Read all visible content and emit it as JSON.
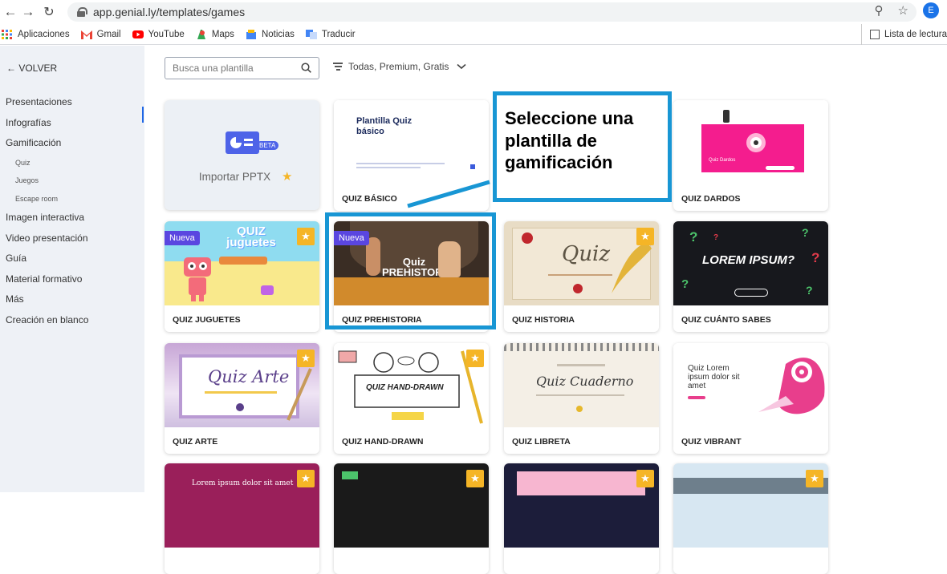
{
  "browser": {
    "url": "app.genial.ly/templates/games",
    "profile_initial": "E",
    "bookmarks": [
      "Aplicaciones",
      "Gmail",
      "YouTube",
      "Maps",
      "Noticias",
      "Traducir"
    ],
    "reading_list": "Lista de lectura"
  },
  "sidebar": {
    "back": "← VOLVER",
    "items": [
      "Presentaciones",
      "Infografías",
      "Gamificación"
    ],
    "subitems": [
      "Quiz",
      "Juegos",
      "Escape room"
    ],
    "items_after": [
      "Imagen interactiva",
      "Video presentación",
      "Guía",
      "Material formativo",
      "Más",
      "Creación en blanco"
    ]
  },
  "toolbar": {
    "search_placeholder": "Busca una plantilla",
    "filter": "Todas, Premium, Gratis"
  },
  "import_card": {
    "label": "Importar PPTX",
    "badge": "BETA"
  },
  "callout": {
    "text": "Seleccione una plantilla de gamificación"
  },
  "badges": {
    "nueva": "Nueva"
  },
  "cards": [
    {
      "title": "QUIZ BÁSICO",
      "thumb_title": "Plantilla Quiz básico"
    },
    {
      "title": "QUIZ DARDOS",
      "thumb_title": "Quiz Dardos"
    },
    {
      "title": "QUIZ JUGUETES",
      "thumb_title": "QUIZ juguetes",
      "new": true,
      "premium": true
    },
    {
      "title": "QUIZ PREHISTORIA",
      "thumb_title": "Quiz PREHISTORIA",
      "new": true
    },
    {
      "title": "QUIZ HISTORIA",
      "thumb_title": "Quiz",
      "premium": true
    },
    {
      "title": "QUIZ CUÁNTO SABES",
      "thumb_title": "LOREM IPSUM?"
    },
    {
      "title": "QUIZ ARTE",
      "thumb_title": "Quiz Arte",
      "premium": true
    },
    {
      "title": "QUIZ HAND-DRAWN",
      "thumb_title": "QUIZ HAND-DRAWN",
      "premium": true
    },
    {
      "title": "QUIZ LIBRETA",
      "thumb_title": "Quiz Cuaderno"
    },
    {
      "title": "QUIZ VIBRANT",
      "thumb_title": "Quiz Lorem ipsum dolor sit amet"
    }
  ],
  "bottom_row": {
    "thumb_text": "Lorem ipsum dolor sit amet"
  },
  "colors": {
    "accent": "#1896d4",
    "brand": "#5a46e0",
    "premium": "#f5b526"
  }
}
